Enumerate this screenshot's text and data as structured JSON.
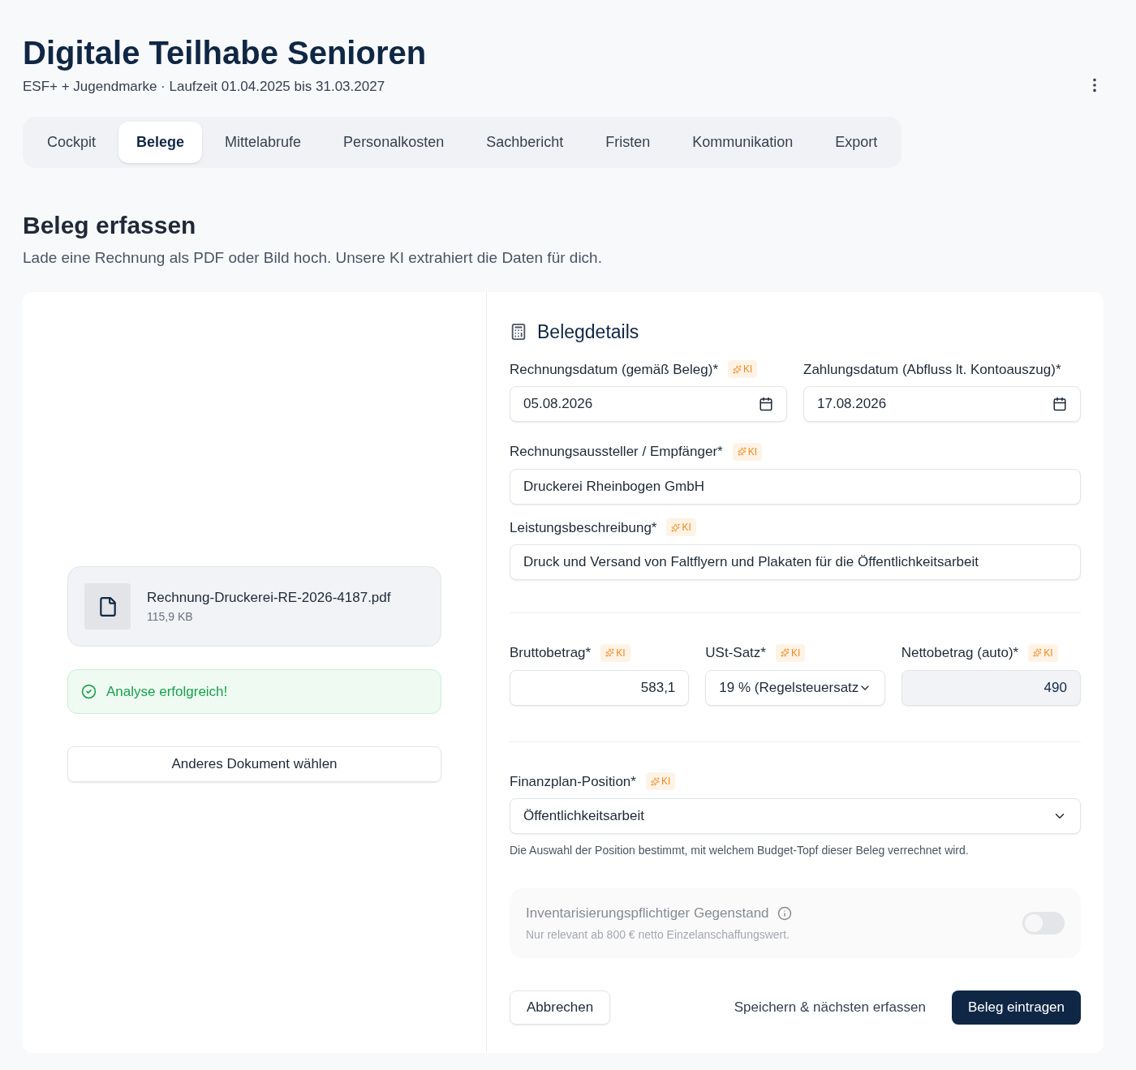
{
  "header": {
    "title": "Digitale Teilhabe Senioren",
    "subtitle": "ESF+ + Jugendmarke · Laufzeit 01.04.2025 bis 31.03.2027"
  },
  "tabs": [
    {
      "label": "Cockpit",
      "selected": false
    },
    {
      "label": "Belege",
      "selected": true
    },
    {
      "label": "Mittelabrufe",
      "selected": false
    },
    {
      "label": "Personalkosten",
      "selected": false
    },
    {
      "label": "Sachbericht",
      "selected": false
    },
    {
      "label": "Fristen",
      "selected": false
    },
    {
      "label": "Kommunikation",
      "selected": false
    },
    {
      "label": "Export",
      "selected": false
    }
  ],
  "section": {
    "title": "Beleg erfassen",
    "description": "Lade eine Rechnung als PDF oder Bild hoch. Unsere KI extrahiert die Daten für dich."
  },
  "upload": {
    "file_name": "Rechnung-Druckerei-RE-2026-4187.pdf",
    "file_size": "115,9 KB",
    "status": "Analyse erfolgreich!",
    "change_button": "Anderes Dokument wählen"
  },
  "details": {
    "title": "Belegdetails",
    "invoice_date": {
      "label": "Rechnungsdatum (gemäß Beleg)*",
      "badge": "KI",
      "value": "05.08.2026"
    },
    "payment_date": {
      "label": "Zahlungsdatum (Abfluss lt. Kontoauszug)*",
      "value": "17.08.2026"
    },
    "issuer": {
      "label": "Rechnungsaussteller / Empfänger*",
      "badge": "KI",
      "value": "Druckerei Rheinbogen GmbH"
    },
    "service": {
      "label": "Leistungsbeschreibung*",
      "badge": "KI",
      "value": "Druck und Versand von Faltflyern und Plakaten für die Öffentlichkeitsarbeit"
    },
    "gross": {
      "label": "Bruttobetrag*",
      "badge": "KI",
      "value": "583,1"
    },
    "vat": {
      "label": "USt-Satz*",
      "badge": "KI",
      "value": "19 % (Regelsteuersatz"
    },
    "net": {
      "label": "Nettobetrag (auto)*",
      "badge": "KI",
      "value": "490"
    },
    "position": {
      "label": "Finanzplan-Position*",
      "badge": "KI",
      "value": "Öffentlichkeitsarbeit",
      "hint": "Die Auswahl der Position bestimmt, mit welchem Budget-Topf dieser Beleg verrechnet wird."
    },
    "inventory": {
      "label": "Inventarisierungspflichtiger Gegenstand",
      "hint": "Nur relevant ab 800 € netto Einzelanschaffungswert.",
      "on": false,
      "disabled": true
    }
  },
  "buttons": {
    "cancel": "Abbrechen",
    "save_next": "Speichern & nächsten erfassen",
    "submit": "Beleg eintragen"
  }
}
